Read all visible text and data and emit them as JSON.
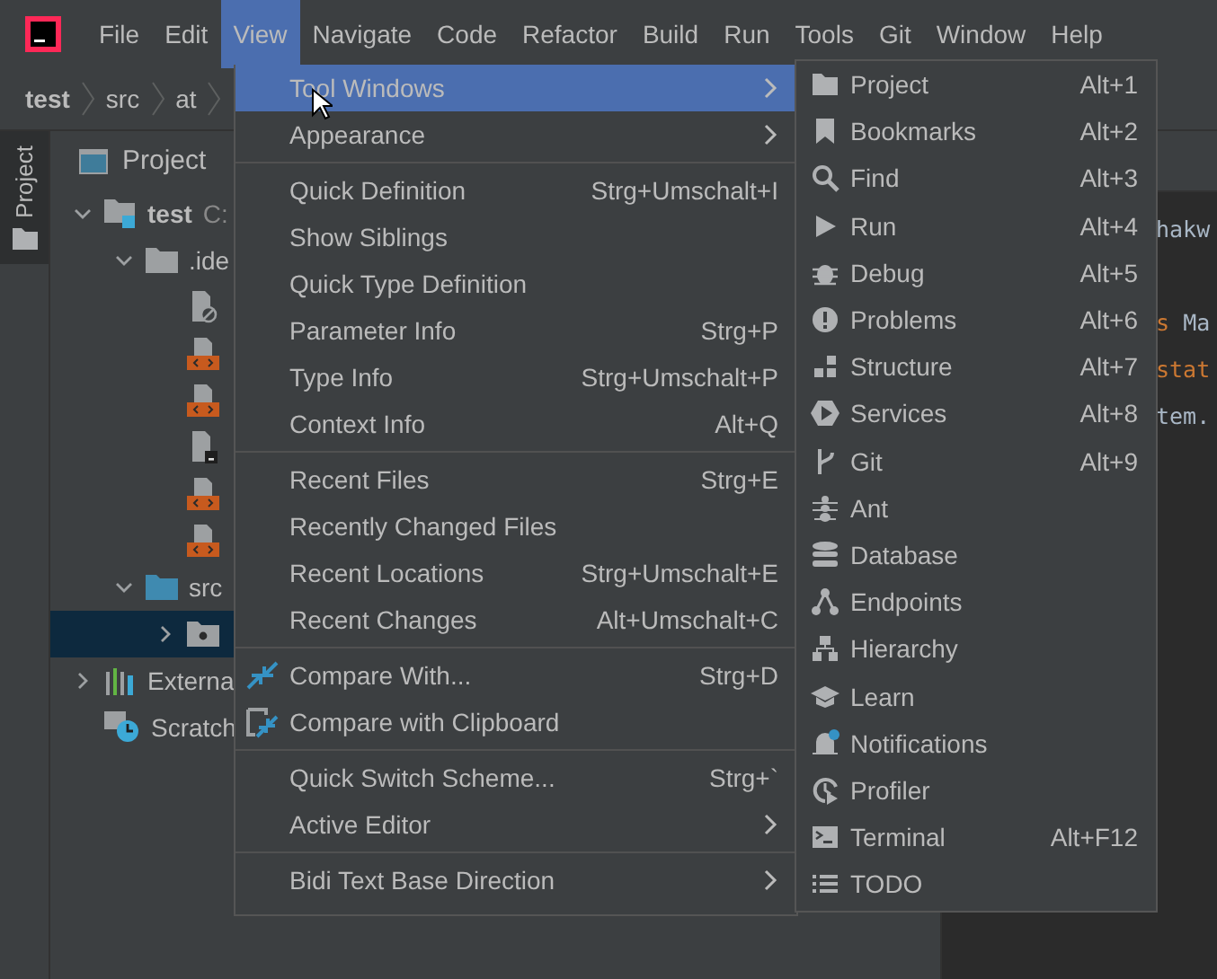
{
  "menubar": [
    {
      "label": "File",
      "selected": false
    },
    {
      "label": "Edit",
      "selected": false
    },
    {
      "label": "View",
      "selected": true
    },
    {
      "label": "Navigate",
      "selected": false
    },
    {
      "label": "Code",
      "selected": false
    },
    {
      "label": "Refactor",
      "selected": false
    },
    {
      "label": "Build",
      "selected": false
    },
    {
      "label": "Run",
      "selected": false
    },
    {
      "label": "Tools",
      "selected": false
    },
    {
      "label": "Git",
      "selected": false
    },
    {
      "label": "Window",
      "selected": false
    },
    {
      "label": "Help",
      "selected": false
    }
  ],
  "breadcrumbs": [
    "test",
    "src",
    "at"
  ],
  "side_stripe": {
    "label": "Project",
    "selected": true
  },
  "project_panel": {
    "title": "Project",
    "tree": [
      {
        "label": "test",
        "extra": "C:",
        "kind": "module",
        "expanded": true,
        "selected": false,
        "children": [
          {
            "label": ".ide",
            "kind": "folder",
            "expanded": true,
            "selected": false,
            "children": [
              {
                "kind": "ignored",
                "selected": false
              },
              {
                "kind": "xml",
                "selected": false
              },
              {
                "kind": "xml",
                "selected": false
              },
              {
                "kind": "text",
                "selected": false
              },
              {
                "kind": "xml",
                "selected": false
              },
              {
                "kind": "xml",
                "selected": false
              }
            ]
          },
          {
            "label": "src",
            "kind": "source",
            "expanded": true,
            "selected": false,
            "children": [
              {
                "kind": "package",
                "expanded": false,
                "selected": true
              }
            ]
          }
        ]
      },
      {
        "label": "Externa",
        "kind": "libraries",
        "expanded": false,
        "selected": false
      },
      {
        "label": "Scratch",
        "kind": "scratch",
        "selected": false
      }
    ]
  },
  "editor": {
    "lines": [
      {
        "segments": [
          {
            "text": "hakw",
            "kind": "plain"
          }
        ]
      },
      {
        "segments": [
          {
            "text": "s ",
            "kind": "keyword"
          },
          {
            "text": "Ma",
            "kind": "plain"
          }
        ]
      },
      {
        "segments": [
          {
            "text": "stat",
            "kind": "keyword"
          }
        ]
      },
      {
        "segments": [
          {
            "text": "tem.",
            "kind": "plain"
          }
        ]
      }
    ]
  },
  "view_menu": {
    "groups": [
      [
        {
          "label": "Tool Windows",
          "selected": true,
          "submenu": true
        },
        {
          "label": "Appearance",
          "selected": false,
          "submenu": true
        }
      ],
      [
        {
          "label": "Quick Definition",
          "shortcut": "Strg+Umschalt+I",
          "selected": false
        },
        {
          "label": "Show Siblings",
          "selected": false
        },
        {
          "label": "Quick Type Definition",
          "selected": false
        },
        {
          "label": "Parameter Info",
          "shortcut": "Strg+P",
          "selected": false
        },
        {
          "label": "Type Info",
          "shortcut": "Strg+Umschalt+P",
          "selected": false
        },
        {
          "label": "Context Info",
          "shortcut": "Alt+Q",
          "selected": false
        }
      ],
      [
        {
          "label": "Recent Files",
          "shortcut": "Strg+E",
          "selected": false
        },
        {
          "label": "Recently Changed Files",
          "selected": false
        },
        {
          "label": "Recent Locations",
          "shortcut": "Strg+Umschalt+E",
          "selected": false
        },
        {
          "label": "Recent Changes",
          "shortcut": "Alt+Umschalt+C",
          "selected": false
        }
      ],
      [
        {
          "label": "Compare With...",
          "shortcut": "Strg+D",
          "selected": false,
          "kind": "compare"
        },
        {
          "label": "Compare with Clipboard",
          "selected": false,
          "kind": "clipboard"
        }
      ],
      [
        {
          "label": "Quick Switch Scheme...",
          "shortcut": "Strg+`",
          "selected": false
        },
        {
          "label": "Active Editor",
          "selected": false,
          "submenu": true
        }
      ],
      [
        {
          "label": "Bidi Text Base Direction",
          "selected": false,
          "submenu": true
        }
      ]
    ]
  },
  "tool_windows_menu": [
    {
      "label": "Project",
      "shortcut": "Alt+1",
      "selected": false
    },
    {
      "label": "Bookmarks",
      "shortcut": "Alt+2",
      "selected": false
    },
    {
      "label": "Find",
      "shortcut": "Alt+3",
      "selected": false
    },
    {
      "label": "Run",
      "shortcut": "Alt+4",
      "selected": false
    },
    {
      "label": "Debug",
      "shortcut": "Alt+5",
      "selected": false
    },
    {
      "label": "Problems",
      "shortcut": "Alt+6",
      "selected": false
    },
    {
      "label": "Structure",
      "shortcut": "Alt+7",
      "selected": false
    },
    {
      "label": "Services",
      "shortcut": "Alt+8",
      "selected": false
    },
    {
      "label": "Git",
      "shortcut": "Alt+9",
      "selected": false
    },
    {
      "label": "Ant",
      "selected": false
    },
    {
      "label": "Database",
      "selected": false
    },
    {
      "label": "Endpoints",
      "selected": false
    },
    {
      "label": "Hierarchy",
      "selected": false
    },
    {
      "label": "Learn",
      "selected": false
    },
    {
      "label": "Notifications",
      "selected": false
    },
    {
      "label": "Profiler",
      "selected": false
    },
    {
      "label": "Terminal",
      "shortcut": "Alt+F12",
      "selected": false
    },
    {
      "label": "TODO",
      "selected": false
    }
  ]
}
